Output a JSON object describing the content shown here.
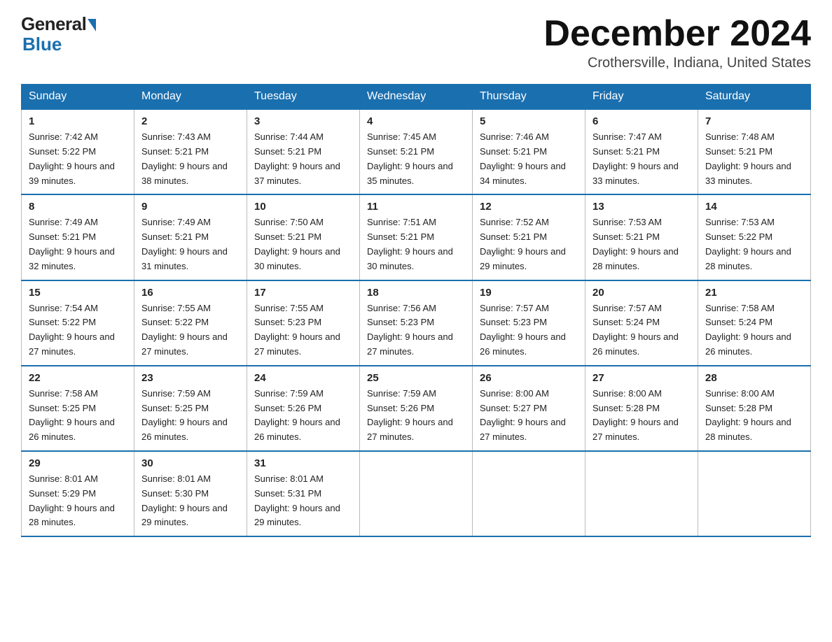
{
  "header": {
    "logo_general": "General",
    "logo_blue": "Blue",
    "month_title": "December 2024",
    "location": "Crothersville, Indiana, United States"
  },
  "weekdays": [
    "Sunday",
    "Monday",
    "Tuesday",
    "Wednesday",
    "Thursday",
    "Friday",
    "Saturday"
  ],
  "weeks": [
    [
      {
        "day": "1",
        "sunrise": "7:42 AM",
        "sunset": "5:22 PM",
        "daylight": "9 hours and 39 minutes."
      },
      {
        "day": "2",
        "sunrise": "7:43 AM",
        "sunset": "5:21 PM",
        "daylight": "9 hours and 38 minutes."
      },
      {
        "day": "3",
        "sunrise": "7:44 AM",
        "sunset": "5:21 PM",
        "daylight": "9 hours and 37 minutes."
      },
      {
        "day": "4",
        "sunrise": "7:45 AM",
        "sunset": "5:21 PM",
        "daylight": "9 hours and 35 minutes."
      },
      {
        "day": "5",
        "sunrise": "7:46 AM",
        "sunset": "5:21 PM",
        "daylight": "9 hours and 34 minutes."
      },
      {
        "day": "6",
        "sunrise": "7:47 AM",
        "sunset": "5:21 PM",
        "daylight": "9 hours and 33 minutes."
      },
      {
        "day": "7",
        "sunrise": "7:48 AM",
        "sunset": "5:21 PM",
        "daylight": "9 hours and 33 minutes."
      }
    ],
    [
      {
        "day": "8",
        "sunrise": "7:49 AM",
        "sunset": "5:21 PM",
        "daylight": "9 hours and 32 minutes."
      },
      {
        "day": "9",
        "sunrise": "7:49 AM",
        "sunset": "5:21 PM",
        "daylight": "9 hours and 31 minutes."
      },
      {
        "day": "10",
        "sunrise": "7:50 AM",
        "sunset": "5:21 PM",
        "daylight": "9 hours and 30 minutes."
      },
      {
        "day": "11",
        "sunrise": "7:51 AM",
        "sunset": "5:21 PM",
        "daylight": "9 hours and 30 minutes."
      },
      {
        "day": "12",
        "sunrise": "7:52 AM",
        "sunset": "5:21 PM",
        "daylight": "9 hours and 29 minutes."
      },
      {
        "day": "13",
        "sunrise": "7:53 AM",
        "sunset": "5:21 PM",
        "daylight": "9 hours and 28 minutes."
      },
      {
        "day": "14",
        "sunrise": "7:53 AM",
        "sunset": "5:22 PM",
        "daylight": "9 hours and 28 minutes."
      }
    ],
    [
      {
        "day": "15",
        "sunrise": "7:54 AM",
        "sunset": "5:22 PM",
        "daylight": "9 hours and 27 minutes."
      },
      {
        "day": "16",
        "sunrise": "7:55 AM",
        "sunset": "5:22 PM",
        "daylight": "9 hours and 27 minutes."
      },
      {
        "day": "17",
        "sunrise": "7:55 AM",
        "sunset": "5:23 PM",
        "daylight": "9 hours and 27 minutes."
      },
      {
        "day": "18",
        "sunrise": "7:56 AM",
        "sunset": "5:23 PM",
        "daylight": "9 hours and 27 minutes."
      },
      {
        "day": "19",
        "sunrise": "7:57 AM",
        "sunset": "5:23 PM",
        "daylight": "9 hours and 26 minutes."
      },
      {
        "day": "20",
        "sunrise": "7:57 AM",
        "sunset": "5:24 PM",
        "daylight": "9 hours and 26 minutes."
      },
      {
        "day": "21",
        "sunrise": "7:58 AM",
        "sunset": "5:24 PM",
        "daylight": "9 hours and 26 minutes."
      }
    ],
    [
      {
        "day": "22",
        "sunrise": "7:58 AM",
        "sunset": "5:25 PM",
        "daylight": "9 hours and 26 minutes."
      },
      {
        "day": "23",
        "sunrise": "7:59 AM",
        "sunset": "5:25 PM",
        "daylight": "9 hours and 26 minutes."
      },
      {
        "day": "24",
        "sunrise": "7:59 AM",
        "sunset": "5:26 PM",
        "daylight": "9 hours and 26 minutes."
      },
      {
        "day": "25",
        "sunrise": "7:59 AM",
        "sunset": "5:26 PM",
        "daylight": "9 hours and 27 minutes."
      },
      {
        "day": "26",
        "sunrise": "8:00 AM",
        "sunset": "5:27 PM",
        "daylight": "9 hours and 27 minutes."
      },
      {
        "day": "27",
        "sunrise": "8:00 AM",
        "sunset": "5:28 PM",
        "daylight": "9 hours and 27 minutes."
      },
      {
        "day": "28",
        "sunrise": "8:00 AM",
        "sunset": "5:28 PM",
        "daylight": "9 hours and 28 minutes."
      }
    ],
    [
      {
        "day": "29",
        "sunrise": "8:01 AM",
        "sunset": "5:29 PM",
        "daylight": "9 hours and 28 minutes."
      },
      {
        "day": "30",
        "sunrise": "8:01 AM",
        "sunset": "5:30 PM",
        "daylight": "9 hours and 29 minutes."
      },
      {
        "day": "31",
        "sunrise": "8:01 AM",
        "sunset": "5:31 PM",
        "daylight": "9 hours and 29 minutes."
      },
      null,
      null,
      null,
      null
    ]
  ]
}
